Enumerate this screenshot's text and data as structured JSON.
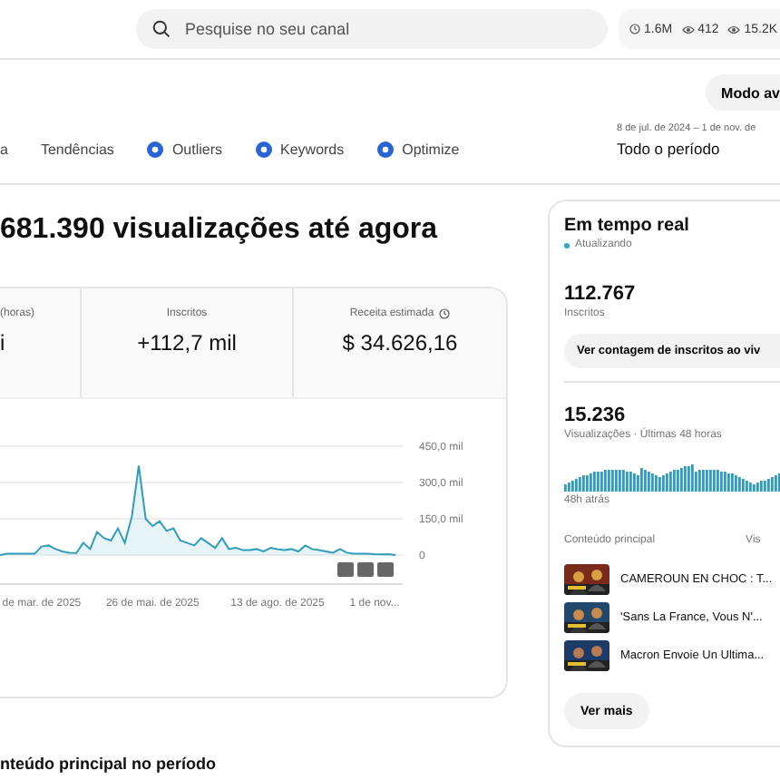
{
  "search": {
    "placeholder": "Pesquise no seu canal"
  },
  "stats_chip": [
    {
      "kind": "clock",
      "text": "1.6M"
    },
    {
      "kind": "eye",
      "text": "412"
    },
    {
      "kind": "eye",
      "text": "15.2K"
    }
  ],
  "mode_button": "Modo av",
  "tabs": [
    {
      "label": "a",
      "icon": false,
      "selected": false
    },
    {
      "label": "Tendências",
      "icon": false,
      "selected": false
    },
    {
      "label": "Outliers",
      "icon": true,
      "selected": false
    },
    {
      "label": "Keywords",
      "icon": true,
      "selected": false
    },
    {
      "label": "Optimize",
      "icon": true,
      "selected": false
    }
  ],
  "period": {
    "range": "8 de jul. de 2024 – 1 de nov. de",
    "label": "Todo o período"
  },
  "headline": "681.390 visualizações até agora",
  "metrics": [
    {
      "label": "(horas)",
      "value": "i",
      "info": false
    },
    {
      "label": "Inscritos",
      "value": "+112,7 mil",
      "info": false
    },
    {
      "label": "Receita estimada",
      "value": "$ 34.626,16",
      "info": true
    }
  ],
  "chart": {
    "chart_data": {
      "type": "area",
      "categories": [
        null,
        null,
        null,
        null,
        null,
        null,
        "de mar. de 2025",
        null,
        null,
        null,
        null,
        null,
        null,
        null,
        null,
        null,
        null,
        null,
        null,
        null,
        null,
        null,
        "26 de mai. de 2025",
        null,
        null,
        null,
        null,
        null,
        null,
        null,
        null,
        null,
        null,
        null,
        null,
        null,
        null,
        null,
        null,
        null,
        "13 de ago. de 2025",
        null,
        null,
        null,
        null,
        null,
        null,
        null,
        null,
        null,
        null,
        null,
        null,
        null,
        "1 de nov...",
        null,
        null,
        null
      ],
      "yticks": [
        {
          "value": 0,
          "label": "0"
        },
        {
          "value": 150,
          "label": "150,0 mil"
        },
        {
          "value": 300,
          "label": "300,0 mil"
        },
        {
          "value": 450,
          "label": "450,0 mil"
        }
      ],
      "ylim": [
        0,
        450
      ],
      "series": [
        {
          "color": "#2f9dbb",
          "values": [
            0,
            5,
            5,
            5,
            5,
            5,
            35,
            40,
            25,
            15,
            10,
            8,
            50,
            25,
            95,
            70,
            60,
            110,
            50,
            160,
            370,
            150,
            120,
            140,
            100,
            110,
            60,
            50,
            40,
            70,
            50,
            30,
            70,
            25,
            30,
            20,
            20,
            25,
            15,
            30,
            25,
            20,
            25,
            15,
            40,
            25,
            20,
            15,
            10,
            25,
            10,
            5,
            5,
            5,
            4,
            3,
            4,
            0
          ]
        }
      ]
    }
  },
  "realtime": {
    "title": "Em tempo real",
    "status": "Atualizando",
    "subscribers": "112.767",
    "subscribers_label": "Inscritos",
    "live_button": "Ver contagem de inscritos ao viv",
    "views": "15.236",
    "views_label": "Visualizações · Últimas 48 horas",
    "since": "48h atrás",
    "content_header": "Conteúdo principal",
    "views_header": "Vis",
    "videos": [
      {
        "title": "CAMEROUN EN CHOC : T..."
      },
      {
        "title": "'Sans La France, Vous N'..."
      },
      {
        "title": "Macron Envoie Un Ultima..."
      }
    ],
    "more_button": "Ver mais"
  },
  "section_title": "nteúdo principal no período"
}
